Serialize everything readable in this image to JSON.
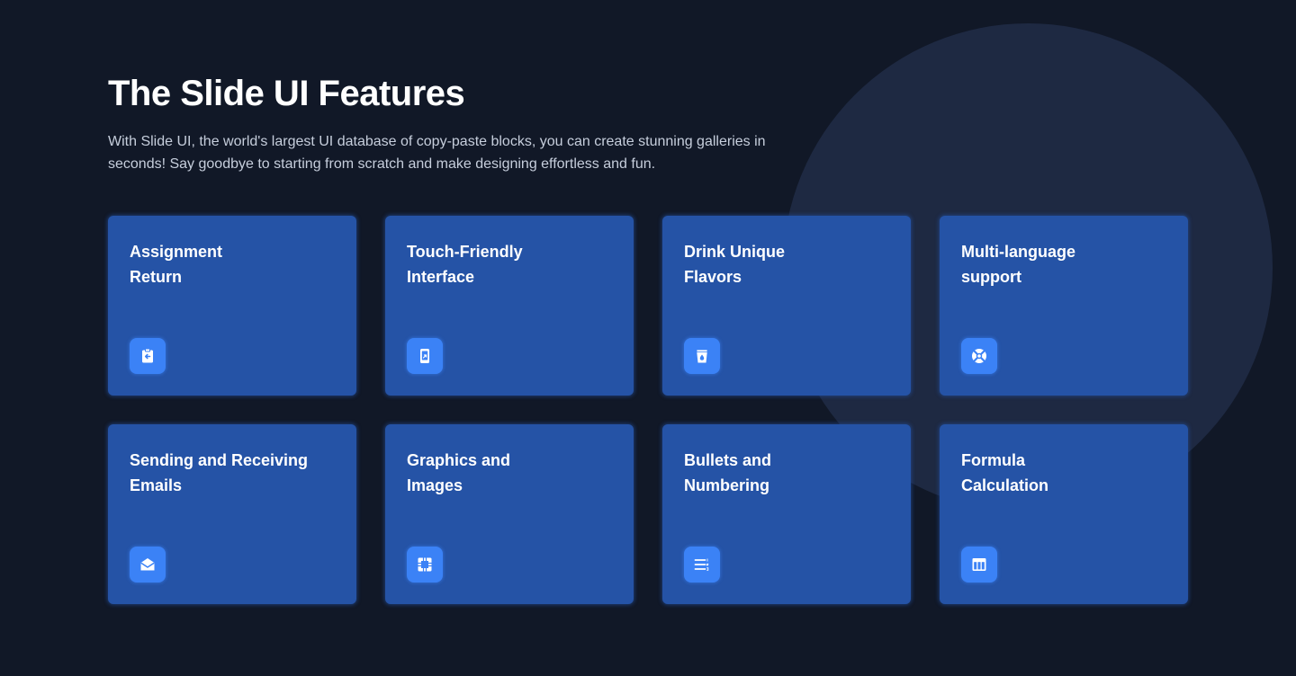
{
  "header": {
    "title": "The Slide UI Features",
    "subtitle": "With Slide UI, the world's largest UI database of copy-paste blocks, you can create stunning galleries in seconds! Say goodbye to starting from scratch and make designing effortless and fun."
  },
  "colors": {
    "background": "#111827",
    "circle": "#1e2942",
    "card": "#2553a6",
    "icon_tile": "#3b82f6",
    "text": "#ffffff",
    "subtitle": "#c6cedc"
  },
  "features": [
    {
      "title": "Assignment\nReturn",
      "icon": "clipboard-return-icon"
    },
    {
      "title": "Touch-Friendly\nInterface",
      "icon": "mobile-touch-icon"
    },
    {
      "title": "Drink Unique\nFlavors",
      "icon": "cup-drop-icon"
    },
    {
      "title": "Multi-language\nsupport",
      "icon": "lifebuoy-icon"
    },
    {
      "title": "Sending and Receiving\nEmails",
      "icon": "mail-open-icon"
    },
    {
      "title": "Graphics and\nImages",
      "icon": "image-frame-icon"
    },
    {
      "title": "Bullets and\nNumbering",
      "icon": "numbered-list-icon"
    },
    {
      "title": "Formula\nCalculation",
      "icon": "table-layout-icon"
    }
  ]
}
